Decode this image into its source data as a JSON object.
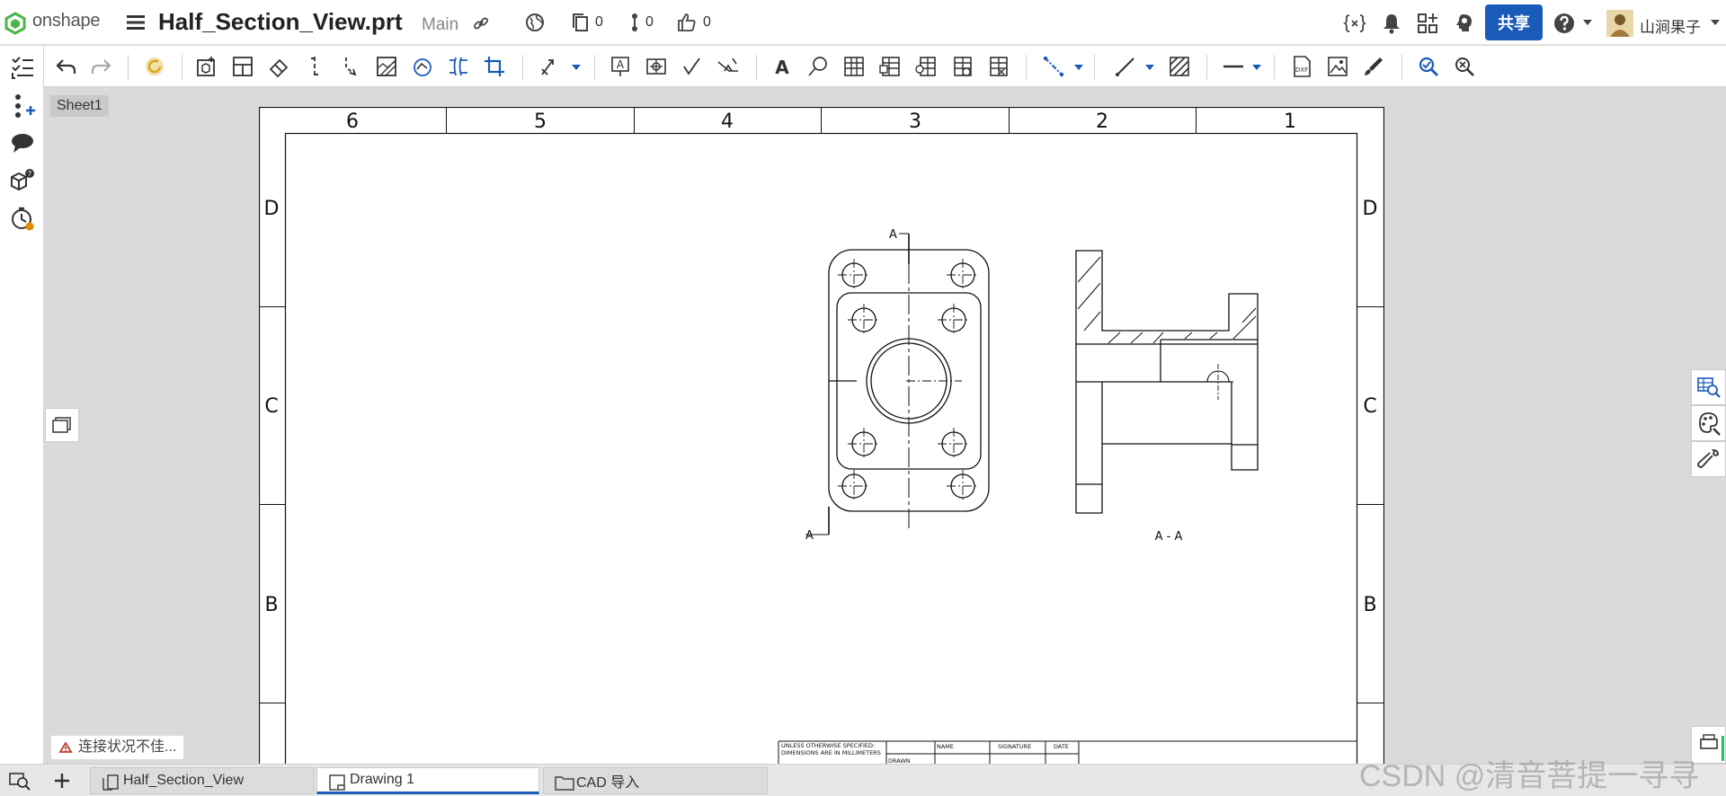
{
  "header": {
    "brand": "onshape",
    "doc_title": "Half_Section_View.prt",
    "branch": "Main",
    "versions_count": "0",
    "branches_count": "0",
    "likes_count": "0",
    "share_label": "共享",
    "user_name": "山涧果子"
  },
  "sheet_tab": "Sheet1",
  "drawing": {
    "zones_top": [
      "6",
      "5",
      "4",
      "3",
      "2",
      "1"
    ],
    "zones_side": [
      "D",
      "C",
      "B"
    ],
    "section_marker": "A",
    "section_label": "A - A",
    "title_block": {
      "note_line1": "UNLESS OTHERWISE SPECIFIED:",
      "note_line2": "DIMENSIONS ARE IN MILLIMETERS",
      "col_name": "NAME",
      "col_signature": "SIGNATURE",
      "col_date": "DATE",
      "row_drawn": "DRAWN"
    }
  },
  "status": {
    "connection": "连接状况不佳..."
  },
  "bottom_tabs": [
    {
      "label": "Half_Section_View",
      "icon": "part-studio-icon"
    },
    {
      "label": "Drawing 1",
      "icon": "drawing-icon",
      "active": true
    },
    {
      "label": "CAD 导入",
      "icon": "folder-icon"
    }
  ],
  "watermark": "CSDN @清音菩提一寻寻",
  "colors": {
    "accent": "#1a5ab8",
    "canvas_bg": "#dadada",
    "sheet_bg": "#ffffff",
    "logo_green": "#4bb54a"
  }
}
